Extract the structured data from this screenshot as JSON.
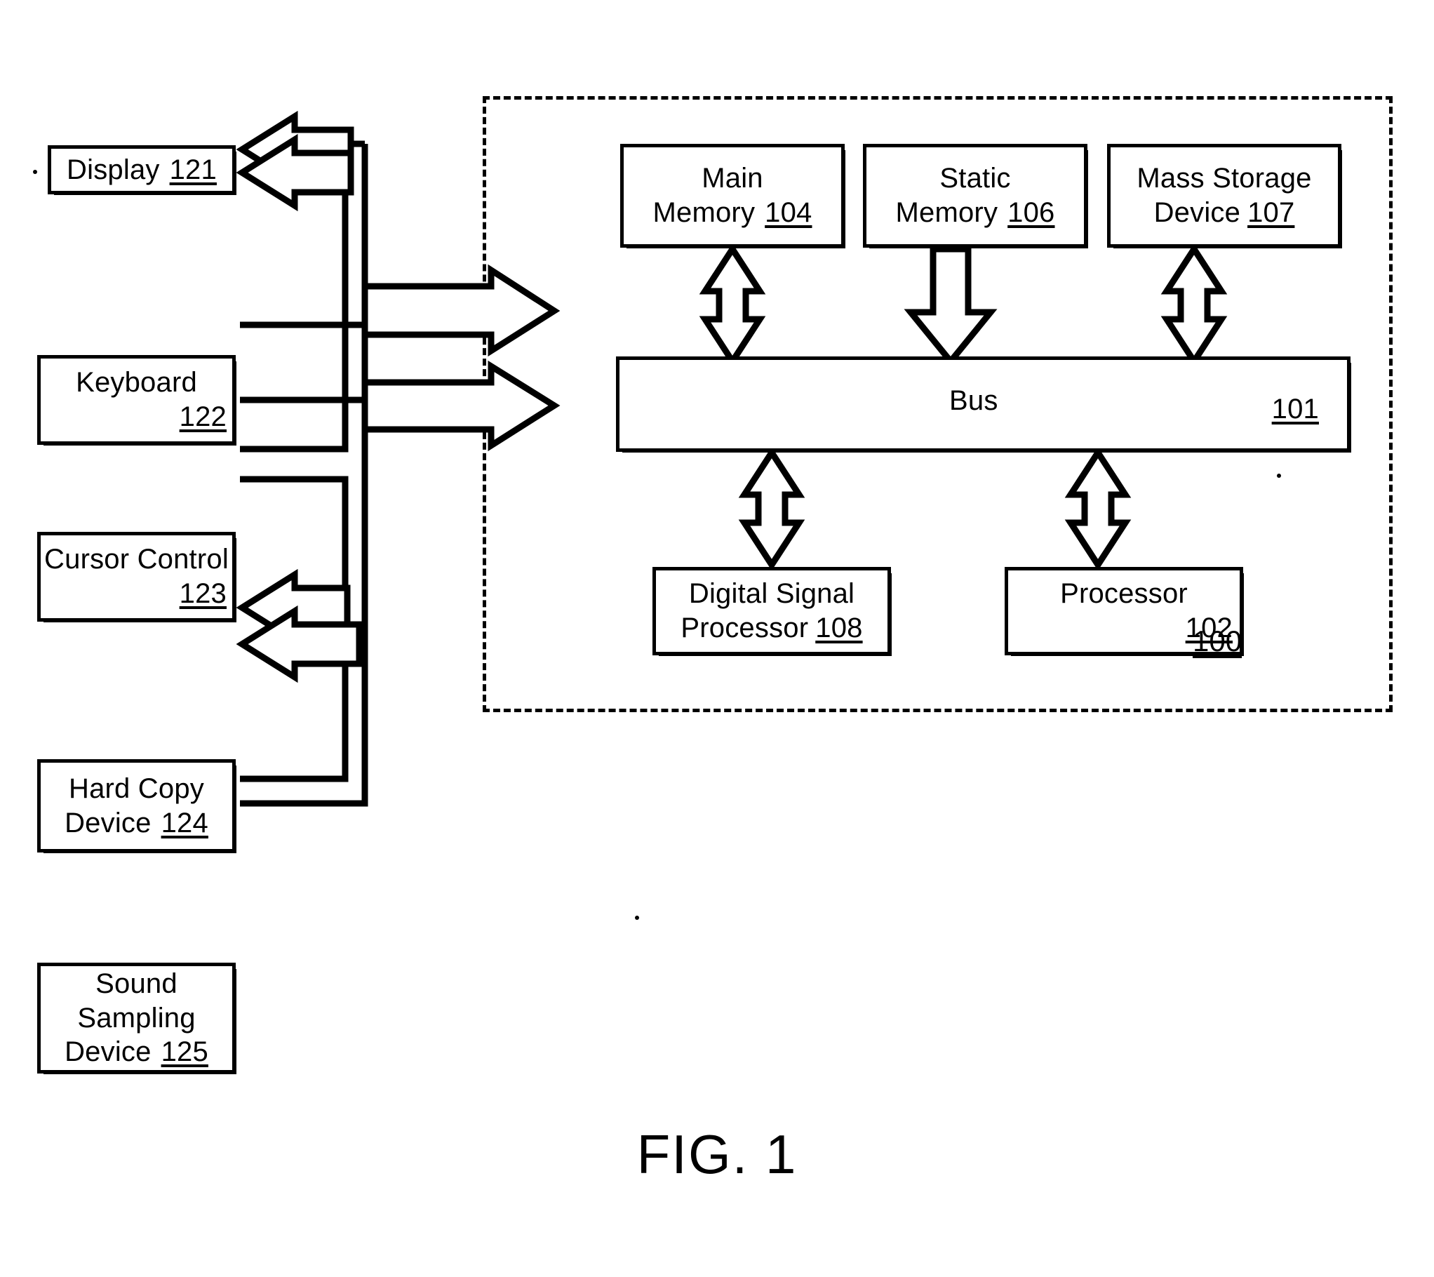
{
  "figure": {
    "caption": "FIG. 1",
    "system_ref": "100"
  },
  "peripherals": [
    {
      "name": "display",
      "lines": [
        "Display"
      ],
      "ref": "121"
    },
    {
      "name": "keyboard",
      "lines": [
        "Keyboard"
      ],
      "ref": "122"
    },
    {
      "name": "cursor-control",
      "lines": [
        "Cursor Control"
      ],
      "ref": "123"
    },
    {
      "name": "hard-copy-device",
      "lines": [
        "Hard Copy",
        "Device"
      ],
      "ref": "124"
    },
    {
      "name": "sound-sampling-device",
      "lines": [
        "Sound",
        "Sampling",
        "Device"
      ],
      "ref": "125"
    }
  ],
  "system": {
    "blocks": [
      {
        "name": "main-memory",
        "lines": [
          "Main",
          "Memory"
        ],
        "ref": "104"
      },
      {
        "name": "static-memory",
        "lines": [
          "Static",
          "Memory"
        ],
        "ref": "106"
      },
      {
        "name": "mass-storage-device",
        "lines": [
          "Mass Storage",
          "Device"
        ],
        "ref": "107"
      },
      {
        "name": "bus",
        "lines": [
          "Bus"
        ],
        "ref": "101"
      },
      {
        "name": "digital-signal-processor",
        "lines": [
          "Digital Signal",
          "Processor"
        ],
        "ref": "108"
      },
      {
        "name": "processor",
        "lines": [
          "Processor"
        ],
        "ref": "102"
      }
    ]
  },
  "labels": {
    "display": "Display",
    "display_ref": "121",
    "keyboard": "Keyboard",
    "keyboard_ref": "122",
    "cursor_control": "Cursor Control",
    "cursor_control_ref": "123",
    "hard_copy_1": "Hard Copy",
    "hard_copy_2": "Device",
    "hard_copy_ref": "124",
    "sound_1": "Sound",
    "sound_2": "Sampling",
    "sound_3": "Device",
    "sound_ref": "125",
    "main_memory_1": "Main",
    "main_memory_2": "Memory",
    "main_memory_ref": "104",
    "static_memory_1": "Static",
    "static_memory_2": "Memory",
    "static_memory_ref": "106",
    "mass_storage_1": "Mass Storage",
    "mass_storage_2": "Device",
    "mass_storage_ref": "107",
    "bus": "Bus",
    "bus_ref": "101",
    "dsp_1": "Digital Signal",
    "dsp_2": "Processor",
    "dsp_ref": "108",
    "processor": "Processor",
    "processor_ref": "102"
  },
  "connections": [
    {
      "from": "bus",
      "to": "main-memory",
      "style": "hollow-double-arrow-vertical"
    },
    {
      "from": "static-memory",
      "to": "bus",
      "style": "hollow-single-arrow-down"
    },
    {
      "from": "bus",
      "to": "mass-storage-device",
      "style": "hollow-double-arrow-vertical"
    },
    {
      "from": "bus",
      "to": "digital-signal-processor",
      "style": "hollow-double-arrow-vertical"
    },
    {
      "from": "bus",
      "to": "processor",
      "style": "hollow-double-arrow-vertical"
    },
    {
      "from": "peripherals",
      "to": "bus",
      "style": "hollow-double-arrow-right"
    },
    {
      "from": "bus",
      "to": "display",
      "style": "hollow-arrow-left"
    },
    {
      "from": "bus",
      "to": "hard-copy-device",
      "style": "hollow-arrow-left"
    }
  ],
  "colors": {
    "stroke": "#000000",
    "background": "#ffffff"
  }
}
